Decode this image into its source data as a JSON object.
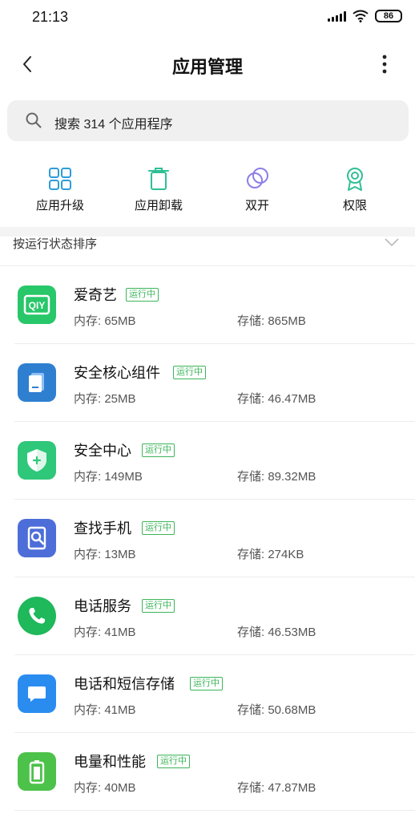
{
  "status_bar": {
    "time": "21:13",
    "battery": "86",
    "icons": [
      "signal-icon",
      "wifi-icon",
      "battery-icon"
    ]
  },
  "header": {
    "title": "应用管理",
    "back_icon": "back-arrow-icon",
    "more_icon": "more-vertical-icon"
  },
  "search": {
    "placeholder": "搜索 314 个应用程序",
    "icon": "search-icon"
  },
  "quick_actions": [
    {
      "label": "应用升级",
      "icon": "grid-icon"
    },
    {
      "label": "应用卸载",
      "icon": "trash-icon"
    },
    {
      "label": "双开",
      "icon": "dual-circle-icon"
    },
    {
      "label": "权限",
      "icon": "badge-icon"
    }
  ],
  "sort": {
    "label": "按运行状态排序",
    "icon": "chevron-down-icon"
  },
  "colors": {
    "running_badge": "#3cb55a",
    "accent": "#2d9cd8"
  },
  "apps": [
    {
      "name": "爱奇艺",
      "status": "运行中",
      "memory": "内存: 65MB",
      "storage": "存储: 865MB",
      "icon": "iqiyi-icon",
      "icon_color": "#28c76a"
    },
    {
      "name": "安全核心组件",
      "status": "运行中",
      "memory": "内存: 25MB",
      "storage": "存储: 46.47MB",
      "icon": "security-core-icon",
      "icon_color": "#2f7fd1"
    },
    {
      "name": "安全中心",
      "status": "运行中",
      "memory": "内存: 149MB",
      "storage": "存储: 89.32MB",
      "icon": "shield-icon",
      "icon_color": "#2fc77a"
    },
    {
      "name": "查找手机",
      "status": "运行中",
      "memory": "内存: 13MB",
      "storage": "存储: 274KB",
      "icon": "find-phone-icon",
      "icon_color": "#4d6ed9"
    },
    {
      "name": "电话服务",
      "status": "运行中",
      "memory": "内存: 41MB",
      "storage": "存储: 46.53MB",
      "icon": "phone-icon",
      "icon_color": "#1fb85b"
    },
    {
      "name": "电话和短信存储",
      "status": "运行中",
      "memory": "内存: 41MB",
      "storage": "存储: 50.68MB",
      "icon": "message-icon",
      "icon_color": "#2b8cf0"
    },
    {
      "name": "电量和性能",
      "status": "运行中",
      "memory": "内存: 40MB",
      "storage": "存储: 47.87MB",
      "icon": "battery-performance-icon",
      "icon_color": "#4cc24a"
    }
  ]
}
